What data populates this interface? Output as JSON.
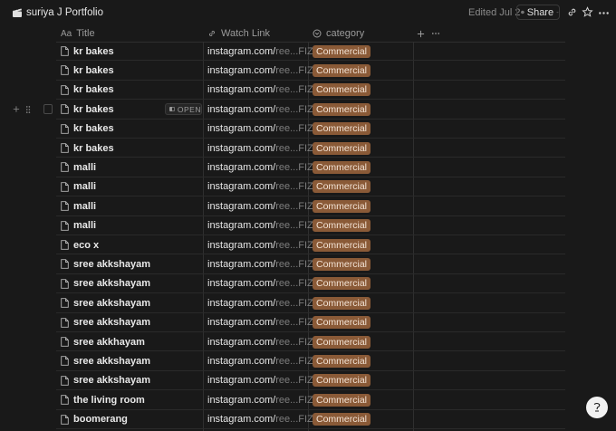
{
  "window": {
    "page_title": "suriya J Portfolio",
    "edited_text": "Edited Jul 2",
    "share_label": "Share"
  },
  "table": {
    "columns": [
      {
        "prefix": "Aa",
        "label": "Title"
      },
      {
        "label": "Watch Link"
      },
      {
        "label": "category"
      }
    ],
    "open_label": "OPEN",
    "rows": [
      {
        "title": "kr bakes",
        "link_main": "instagram.com/",
        "link_tail": "ree...FIZA==",
        "category": "Commercial"
      },
      {
        "title": "kr bakes",
        "link_main": "instagram.com/",
        "link_tail": "ree...FIZA==",
        "category": "Commercial"
      },
      {
        "title": "kr bakes",
        "link_main": "instagram.com/",
        "link_tail": "ree...FIZA==",
        "category": "Commercial"
      },
      {
        "title": "kr bakes",
        "link_main": "instagram.com/",
        "link_tail": "ree...FIZA==",
        "category": "Commercial"
      },
      {
        "title": "kr bakes",
        "link_main": "instagram.com/",
        "link_tail": "ree...FIZA==",
        "category": "Commercial"
      },
      {
        "title": "kr bakes",
        "link_main": "instagram.com/",
        "link_tail": "ree...FIZA==",
        "category": "Commercial"
      },
      {
        "title": "malli",
        "link_main": "instagram.com/",
        "link_tail": "ree...FIZA==",
        "category": "Commercial"
      },
      {
        "title": "malli",
        "link_main": "instagram.com/",
        "link_tail": "ree...FIZA==",
        "category": "Commercial"
      },
      {
        "title": "malli",
        "link_main": "instagram.com/",
        "link_tail": "ree...FIZA==",
        "category": "Commercial"
      },
      {
        "title": "malli",
        "link_main": "instagram.com/",
        "link_tail": "ree...FIZA==",
        "category": "Commercial"
      },
      {
        "title": "eco x",
        "link_main": "instagram.com/",
        "link_tail": "ree...FIZA==",
        "category": "Commercial"
      },
      {
        "title": "sree akkshayam",
        "link_main": "instagram.com/",
        "link_tail": "ree...FIZA==",
        "category": "Commercial"
      },
      {
        "title": "sree akkshayam",
        "link_main": "instagram.com/",
        "link_tail": "ree...FIZA==",
        "category": "Commercial"
      },
      {
        "title": "sree akkshayam",
        "link_main": "instagram.com/",
        "link_tail": "ree...FIZA==",
        "category": "Commercial"
      },
      {
        "title": "sree akkshayam",
        "link_main": "instagram.com/",
        "link_tail": "ree...FIZA==",
        "category": "Commercial"
      },
      {
        "title": "sree akkhayam",
        "link_main": "instagram.com/",
        "link_tail": "ree...FIZA==",
        "category": "Commercial"
      },
      {
        "title": "sree akkshayam",
        "link_main": "instagram.com/",
        "link_tail": "ree...FIZA==",
        "category": "Commercial"
      },
      {
        "title": "sree akkshayam",
        "link_main": "instagram.com/",
        "link_tail": "ree...FIZA==",
        "category": "Commercial"
      },
      {
        "title": "the living room",
        "link_main": "instagram.com/",
        "link_tail": "ree...FIZA==",
        "category": "Commercial"
      },
      {
        "title": "boomerang",
        "link_main": "instagram.com/",
        "link_tail": "ree...FIZA==",
        "category": "Commercial"
      }
    ]
  },
  "icons": {
    "page": "clapperboard-icon",
    "share_chevron": "chevron-down-icon",
    "link": "link-icon",
    "star": "star-icon",
    "more": "more-horizontal-icon",
    "help": "help-icon"
  },
  "colors": {
    "background": "#191919",
    "tag_commercial": "#8a5a37"
  }
}
